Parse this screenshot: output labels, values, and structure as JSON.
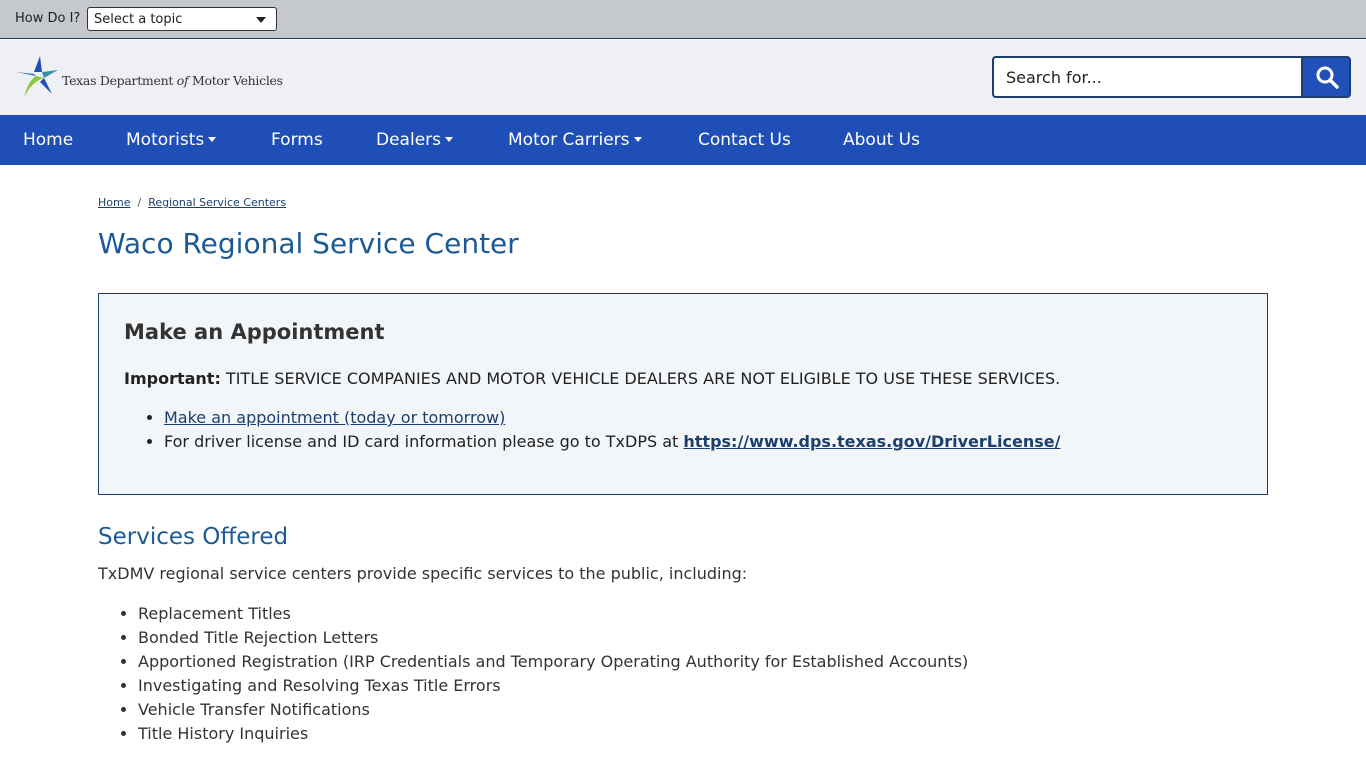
{
  "topbar": {
    "label": "How Do I?",
    "select_value": "Select a topic"
  },
  "header": {
    "logo_text_a": "Texas Department ",
    "logo_text_of": "of",
    "logo_text_b": " Motor Vehicles",
    "search_placeholder": "Search for..."
  },
  "nav": {
    "items": [
      {
        "label": "Home"
      },
      {
        "label": "Motorists"
      },
      {
        "label": "Forms"
      },
      {
        "label": "Dealers"
      },
      {
        "label": "Motor Carriers"
      },
      {
        "label": "Contact Us"
      },
      {
        "label": "About Us"
      }
    ]
  },
  "breadcrumb": {
    "home": "Home",
    "separator": "/",
    "current": "Regional Service Centers"
  },
  "page_title": "Waco Regional Service Center",
  "appointment": {
    "title": "Make an Appointment",
    "important_label": "Important:",
    "important_text": " TITLE SERVICE COMPANIES AND MOTOR VEHICLE DEALERS ARE NOT ELIGIBLE TO USE THESE SERVICES.",
    "link_appointment": "Make an appointment (today or tomorrow)",
    "dps_text": "For driver license and ID card information please go to TxDPS at ",
    "dps_link": "https://www.dps.texas.gov/DriverLicense/"
  },
  "services": {
    "title": "Services Offered",
    "intro": "TxDMV regional service centers provide specific services to the public, including:",
    "items": [
      "Replacement Titles",
      "Bonded Title Rejection Letters",
      "Apportioned Registration (IRP Credentials and Temporary Operating Authority for Established Accounts)",
      "Investigating and Resolving Texas Title Errors",
      "Vehicle Transfer Notifications",
      "Title History Inquiries"
    ]
  },
  "colors": {
    "nav_bg": "#1f4fb6",
    "heading_blue": "#1d5a94",
    "link_navy": "#1d3f6e",
    "logo_blue": "#1f4fb6",
    "logo_green": "#8cc63f",
    "logo_teal": "#3a8fa8"
  }
}
